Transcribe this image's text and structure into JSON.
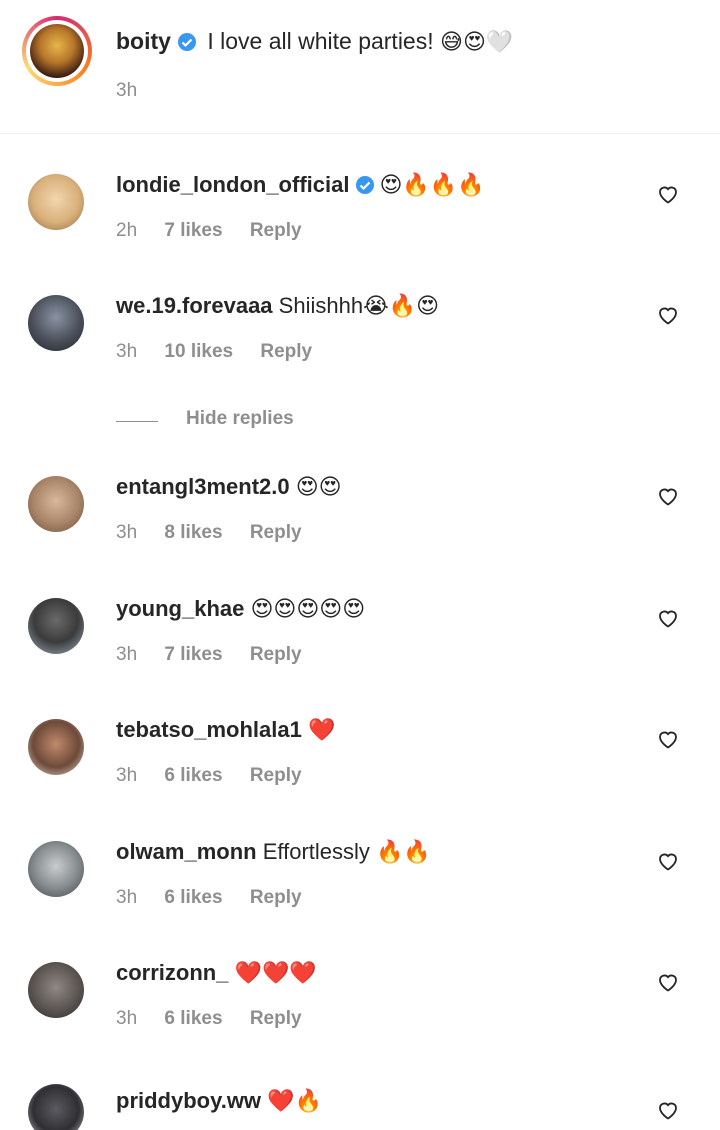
{
  "post": {
    "username": "boity",
    "text": "I love all white parties!",
    "emoji": "😅😍🤍",
    "time": "3h"
  },
  "comments": [
    {
      "username": "londie_london_official",
      "verified": true,
      "text": "",
      "emoji": "😍🔥🔥🔥",
      "time": "2h",
      "likes": "7 likes",
      "reply": "Reply",
      "avatar_color": "#d9b07a"
    },
    {
      "username": "we.19.forevaaa",
      "verified": false,
      "text": "Shiishhh",
      "emoji": "😭🔥😍",
      "time": "3h",
      "likes": "10 likes",
      "reply": "Reply",
      "avatar_color": "#4a4f5a"
    },
    {
      "username": "entangl3ment2.0",
      "verified": false,
      "text": "",
      "emoji": "😍😍",
      "time": "3h",
      "likes": "8 likes",
      "reply": "Reply",
      "avatar_color": "#a88468"
    },
    {
      "username": "young_khae",
      "verified": false,
      "text": "",
      "emoji": "😍😍😍😍😍",
      "time": "3h",
      "likes": "7 likes",
      "reply": "Reply",
      "avatar_color": "#3b3b3b"
    },
    {
      "username": "tebatso_mohlala1",
      "verified": false,
      "text": "",
      "emoji": "❤️",
      "time": "3h",
      "likes": "6 likes",
      "reply": "Reply",
      "avatar_color": "#6e4a3a"
    },
    {
      "username": "olwam_monn",
      "verified": false,
      "text": "Effortlessly",
      "emoji": "🔥🔥",
      "time": "3h",
      "likes": "6 likes",
      "reply": "Reply",
      "avatar_color": "#8a8f92"
    },
    {
      "username": "corrizonn_",
      "verified": false,
      "text": "",
      "emoji": "❤️❤️❤️",
      "time": "3h",
      "likes": "6 likes",
      "reply": "Reply",
      "avatar_color": "#5b5552"
    },
    {
      "username": "priddyboy.ww",
      "verified": false,
      "text": "",
      "emoji": "❤️🔥",
      "time": "",
      "likes": "",
      "reply": "",
      "avatar_color": "#2f2f33"
    }
  ],
  "hide_replies": "Hide replies",
  "icons": {
    "verified": "verified-badge-icon",
    "heart": "heart-outline-icon"
  },
  "colors": {
    "verified": "#3897f0",
    "muted": "#8e8e8e",
    "text": "#262626"
  }
}
